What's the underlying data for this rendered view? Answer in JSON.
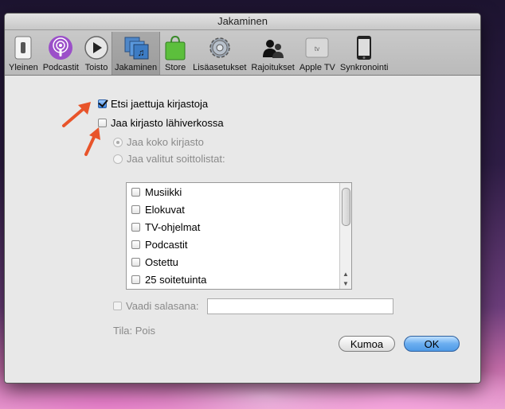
{
  "window": {
    "title": "Jakaminen"
  },
  "toolbar": {
    "items": [
      {
        "label": "Yleinen",
        "icon": "switch-icon"
      },
      {
        "label": "Podcastit",
        "icon": "podcast-icon"
      },
      {
        "label": "Toisto",
        "icon": "play-icon"
      },
      {
        "label": "Jakaminen",
        "icon": "sharing-icon",
        "active": true
      },
      {
        "label": "Store",
        "icon": "shopping-bag-icon"
      },
      {
        "label": "Lisäasetukset",
        "icon": "gear-icon"
      },
      {
        "label": "Rajoitukset",
        "icon": "parental-icon"
      },
      {
        "label": "Apple TV",
        "icon": "apple-tv-icon"
      },
      {
        "label": "Synkronointi",
        "icon": "iphone-icon"
      }
    ]
  },
  "options": {
    "find_shared": {
      "label": "Etsi jaettuja kirjastoja",
      "checked": true
    },
    "share_library": {
      "label": "Jaa kirjasto lähiverkossa",
      "checked": false
    },
    "share_all": {
      "label": "Jaa koko kirjasto"
    },
    "share_selected": {
      "label": "Jaa valitut soittolistat:"
    }
  },
  "playlists": [
    "Musiikki",
    "Elokuvat",
    "TV-ohjelmat",
    "Podcastit",
    "Ostettu",
    "25 soitetuinta"
  ],
  "password": {
    "label": "Vaadi salasana:",
    "value": ""
  },
  "status": "Tila: Pois",
  "buttons": {
    "cancel": "Kumoa",
    "ok": "OK"
  },
  "colors": {
    "accent": "#3f86e0",
    "annotation_arrow": "#e8542a"
  }
}
